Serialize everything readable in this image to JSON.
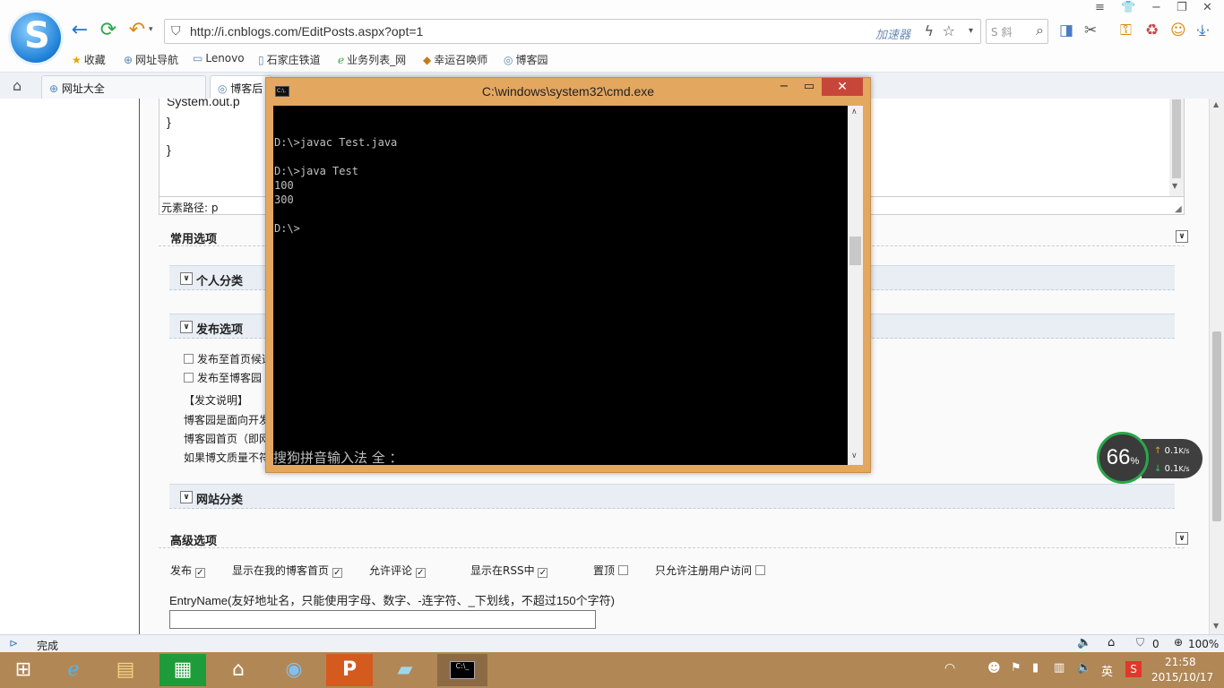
{
  "browser": {
    "url": "http://i.cnblogs.com/EditPosts.aspx?opt=1",
    "accelerator_label": "加速器",
    "search_placeholder": "S 斜",
    "bookmarks": [
      "收藏",
      "网址导航",
      "Lenovo",
      "石家庄铁道",
      "业务列表_网",
      "幸运召唤师",
      "博客园"
    ],
    "tabs": [
      "网址大全",
      "博客后"
    ]
  },
  "editor": {
    "code_line_partial": "System.out.p",
    "brace1": "}",
    "brace2": "}",
    "element_path": "元素路径: p"
  },
  "sections": {
    "common_options": "常用选项",
    "personal_category": "个人分类",
    "publish_options": "发布选项",
    "publish_to_home_candidate": "发布至首页候选",
    "publish_to_blog_garden": "发布至博客园",
    "notes_title": "【发文说明】",
    "note1": "博客园是面向开发",
    "note2": "博客园首页（即网",
    "note3": "如果博文质量不符",
    "site_category": "网站分类",
    "advanced_options": "高级选项"
  },
  "advanced": {
    "publish": "发布",
    "show_on_my_home": "显示在我的博客首页",
    "allow_comments": "允许评论",
    "show_in_rss": "显示在RSS中",
    "pin": "置顶",
    "registered_only": "只允许注册用户访问",
    "entryname_label": "EntryName(友好地址名，只能使用字母、数字、-连字符、_下划线，不超过150个字符)"
  },
  "cmd": {
    "title": "C:\\windows\\system32\\cmd.exe",
    "icon_text": "C:\\.",
    "lines": [
      "D:\\>javac Test.java",
      "",
      "D:\\>java Test",
      "100",
      "300",
      "",
      "D:\\>"
    ],
    "ime_status": "搜狗拼音输入法 全 ："
  },
  "net_widget": {
    "percent": "66",
    "percent_unit": "%",
    "up_rate": "0.1",
    "down_rate": "0.1",
    "rate_unit": "K/s"
  },
  "status": {
    "text": "完成",
    "counter": "0",
    "zoom": "100%"
  },
  "taskbar": {
    "time": "21:58",
    "date": "2015/10/17",
    "ime_lang": "英"
  }
}
